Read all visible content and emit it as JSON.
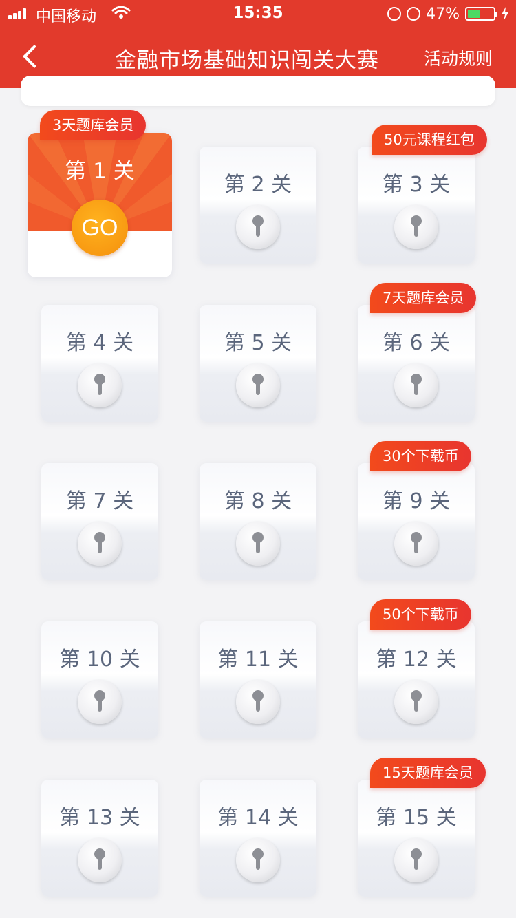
{
  "status_bar": {
    "carrier": "中国移动",
    "time": "15:35",
    "battery": "47%",
    "icons": [
      "signal-icon",
      "wifi-icon",
      "rotation-lock-icon",
      "alarm-icon",
      "battery-icon",
      "charging-icon"
    ]
  },
  "nav": {
    "title": "金融市场基础知识闯关大赛",
    "rules_label": "活动规则",
    "back_icon": "chevron-left-icon"
  },
  "colors": {
    "header": "#e23a2c",
    "go_button": "#f89a12",
    "reward_tag": "#e8352f",
    "level_text": "#5b667c"
  },
  "levels": [
    {
      "label": "第 1 关",
      "state": "unlocked",
      "reward": "3天题库会员",
      "action": "GO"
    },
    {
      "label": "第 2 关",
      "state": "locked"
    },
    {
      "label": "第 3 关",
      "state": "locked",
      "reward": "50元课程红包"
    },
    {
      "label": "第 4 关",
      "state": "locked"
    },
    {
      "label": "第 5 关",
      "state": "locked"
    },
    {
      "label": "第 6 关",
      "state": "locked",
      "reward": "7天题库会员"
    },
    {
      "label": "第 7 关",
      "state": "locked"
    },
    {
      "label": "第 8 关",
      "state": "locked"
    },
    {
      "label": "第 9 关",
      "state": "locked",
      "reward": "30个下载币"
    },
    {
      "label": "第 10 关",
      "state": "locked"
    },
    {
      "label": "第 11 关",
      "state": "locked"
    },
    {
      "label": "第 12 关",
      "state": "locked",
      "reward": "50个下载币"
    },
    {
      "label": "第 13 关",
      "state": "locked"
    },
    {
      "label": "第 14 关",
      "state": "locked"
    },
    {
      "label": "第 15 关",
      "state": "locked",
      "reward": "15天题库会员"
    }
  ]
}
